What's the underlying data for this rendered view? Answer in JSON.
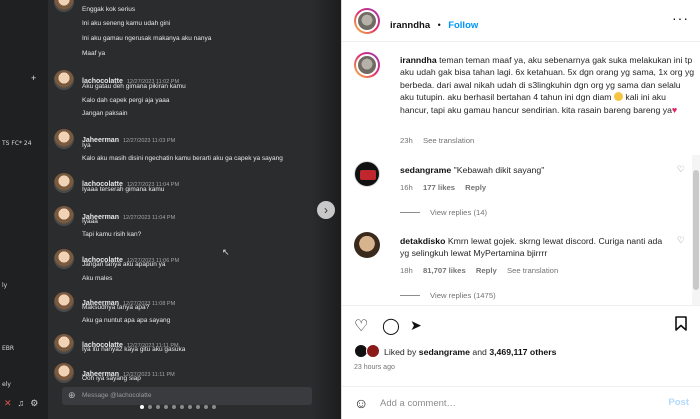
{
  "media": {
    "side_labels": [
      "TS FC* 24",
      "ly",
      "EBR",
      "ely"
    ],
    "messages": [
      {
        "name": "",
        "time": "",
        "lines": [
          "Enggak kok serius",
          "Ini aku seneng kamu udah gini",
          "Ini aku gamau ngerusak makanya aku nanya",
          "Maaf ya"
        ]
      },
      {
        "name": "lachocolatte",
        "time": "12/27/2023 11:02 PM",
        "lines": [
          "Aku gatau deh gimana pikiran kamu",
          "Kalo dah capek pergi aja yaaa",
          "Jangan paksain"
        ]
      },
      {
        "name": "Jaheerman",
        "time": "12/27/2023 11:03 PM",
        "lines": [
          "Iya",
          "Kalo aku masih disini ngechatin kamu berarti aku ga capek ya sayang"
        ]
      },
      {
        "name": "lachocolatte",
        "time": "12/27/2023 11:04 PM",
        "lines": [
          "Iyaaa terserah gimana kamu"
        ]
      },
      {
        "name": "Jaheerman",
        "time": "12/27/2023 11:04 PM",
        "lines": [
          "Iyaaa",
          "Tapi kamu risih kan?"
        ]
      },
      {
        "name": "lachocolatte",
        "time": "12/27/2023 11:06 PM",
        "lines": [
          "Jangan tanya aku apapun ya",
          "Aku males"
        ]
      },
      {
        "name": "Jaheerman",
        "time": "12/27/2023 11:08 PM",
        "lines": [
          "Maksudnya tanya apa?",
          "Aku ga nuntut apa apa sayang"
        ]
      },
      {
        "name": "lachocolatte",
        "time": "12/27/2023 11:11 PM",
        "lines": [
          "Iya itu nanya2 kaya gitu aku gasuka"
        ]
      },
      {
        "name": "Jaheerman",
        "time": "12/27/2023 11:11 PM",
        "lines": [
          "Ooh iya sayang siap"
        ]
      }
    ],
    "input_placeholder": "Message @lachocolatte",
    "carousel_dots": 10,
    "carousel_active": 0
  },
  "post": {
    "username": "iranndha",
    "follow_label": "Follow",
    "separator": "•",
    "caption_user": "iranndha",
    "caption_text_1": "teman teman maaf ya, aku sebenarnya gak suka melakukan ini tp aku udah gak bisa tahan lagi. 6x ketahuan. 5x dgn orang yg sama, 1x org yg berbeda. dari awal nikah udah di s3lingkuhin dgn org yg sama dan selalu aku tutupin. aku berhasil bertahan 4 tahun ini dgn diam",
    "caption_text_2": "kali ini aku hancur, tapi aku gamau hancur sendirian. kita rasain bareng bareng ya",
    "caption_time": "23h",
    "caption_translation": "See translation"
  },
  "comments": [
    {
      "user": "sedangrame",
      "text": "\"Kebawah dikit sayang\"",
      "time": "16h",
      "likes": "177 likes",
      "reply": "Reply",
      "translation": "",
      "view_replies": "View replies (14)"
    },
    {
      "user": "detakdisko",
      "text": "Kmrn lewat gojek. skrng lewat discord. Curiga nanti ada yg selingkuh lewat MyPertamina bjirrrr",
      "time": "18h",
      "likes": "81,707 likes",
      "reply": "Reply",
      "translation": "See translation",
      "view_replies": "View replies (1475)"
    }
  ],
  "likes": {
    "prefix": "Liked by",
    "user": "sedangrame",
    "conjunction": "and",
    "others": "3,469,117 others",
    "ago": "23 hours ago"
  },
  "add_comment": {
    "placeholder": "Add a comment…",
    "post_label": "Post"
  },
  "colors": {
    "accent": "#0095f6",
    "heart": "#e0245e",
    "post_disabled": "#b3dbff"
  }
}
